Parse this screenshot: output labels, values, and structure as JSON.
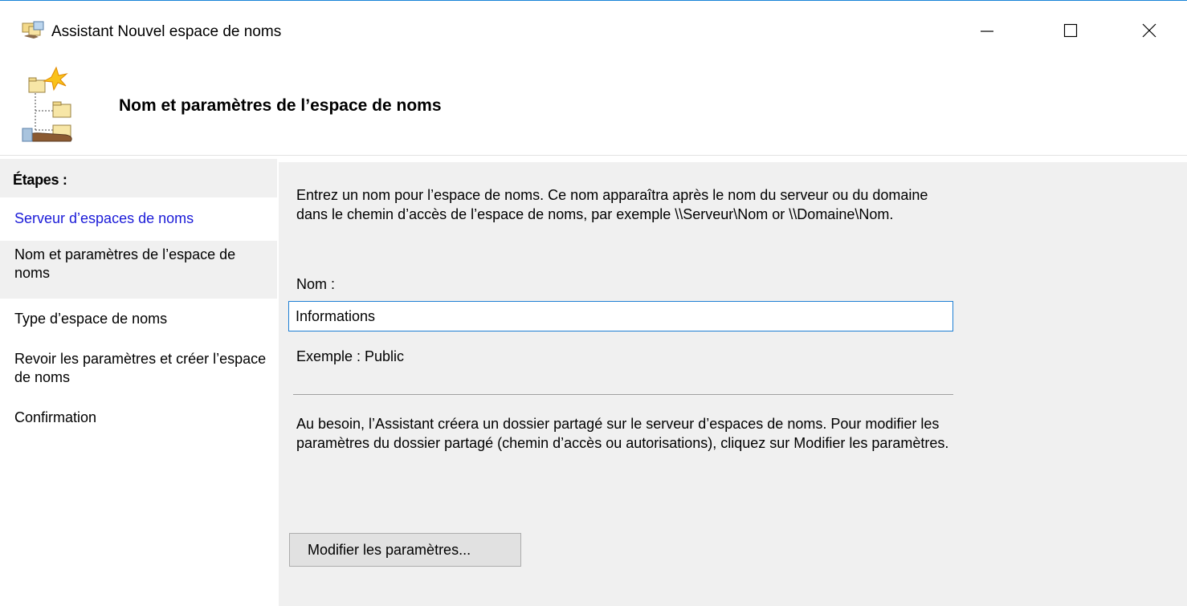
{
  "window": {
    "title": "Assistant Nouvel espace de noms",
    "accent": "#1883d7"
  },
  "header": {
    "title": "Nom et paramètres de l’espace de noms"
  },
  "steps": {
    "heading": "Étapes :",
    "items": [
      {
        "label": "Serveur d’espaces de noms",
        "state": "link"
      },
      {
        "label": "Nom et paramètres de l’espace de noms",
        "state": "current"
      },
      {
        "label": "Type d’espace de noms",
        "state": "normal"
      },
      {
        "label": "Revoir les paramètres et créer l’espace de noms",
        "state": "normal"
      },
      {
        "label": "Confirmation",
        "state": "normal"
      }
    ]
  },
  "main": {
    "description": "Entrez un nom pour l’espace de noms. Ce nom apparaîtra après le nom du serveur ou du domaine dans le chemin d’accès de l’espace de noms, par exemple \\\\Serveur\\Nom or \\\\Domaine\\Nom.",
    "name_label": "Nom :",
    "name_value": "Informations",
    "example": "Exemple : Public",
    "info": "Au besoin, l’Assistant créera un dossier partagé sur le serveur d’espaces de noms. Pour modifier les paramètres du dossier partagé (chemin d’accès ou autorisations), cliquez sur Modifier les paramètres.",
    "modify_button": "Modifier les paramètres..."
  },
  "icons": {
    "app": "namespace-wizard-icon",
    "header": "namespace-tree-icon",
    "minimize": "minimize-icon",
    "maximize": "maximize-icon",
    "close": "close-icon"
  }
}
